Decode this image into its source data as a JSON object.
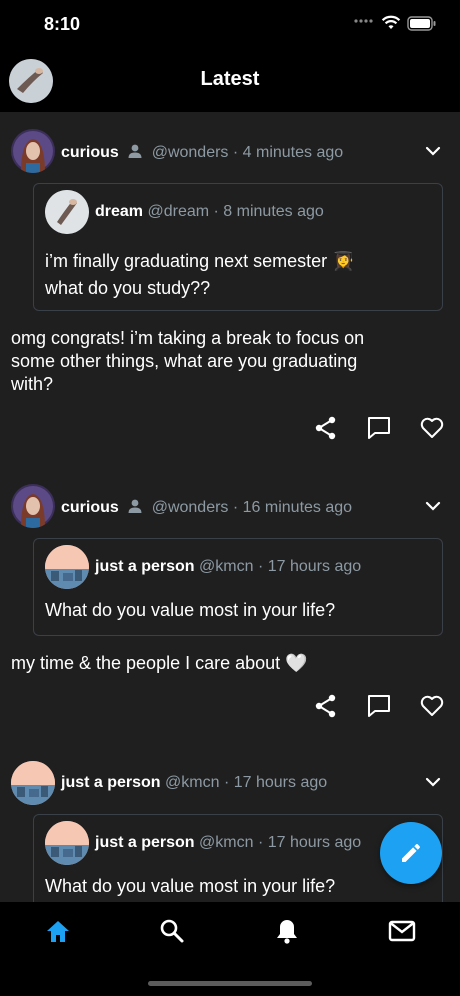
{
  "status_bar": {
    "time": "8:10"
  },
  "header": {
    "title": "Latest"
  },
  "posts": [
    {
      "author": "curious",
      "handle": "@wonders",
      "time": "· 4 minutes ago",
      "quote": {
        "author": "dream",
        "handle": "@dream",
        "time": "· 8 minutes ago",
        "text_line1": "i’m finally graduating next semester 👩‍🎓",
        "text_line2": "what do you study??"
      },
      "text_line1": "omg congrats! i’m taking a break to focus on",
      "text_line2": "some other things, what are you graduating",
      "text_line3": "with?"
    },
    {
      "author": "curious",
      "handle": "@wonders",
      "time": "· 16 minutes ago",
      "quote": {
        "author": "just a person",
        "handle": "@kmcn",
        "time": "· 17 hours ago",
        "text_line1": "What do you value most in your life?"
      },
      "text_line1": "my time & the people I care about 🤍"
    },
    {
      "author": "just a person",
      "handle": "@kmcn",
      "time": "· 17 hours ago",
      "quote": {
        "author": "just a person",
        "handle": "@kmcn",
        "time": "· 17 hours ago",
        "text_line1": "What do you value most in your life?"
      }
    }
  ],
  "tabs": [
    "home",
    "search",
    "notifications",
    "messages"
  ],
  "colors": {
    "accent": "#1da1f2",
    "background": "#1f1f1f",
    "bar": "#000000",
    "muted": "#8d9aa3"
  }
}
